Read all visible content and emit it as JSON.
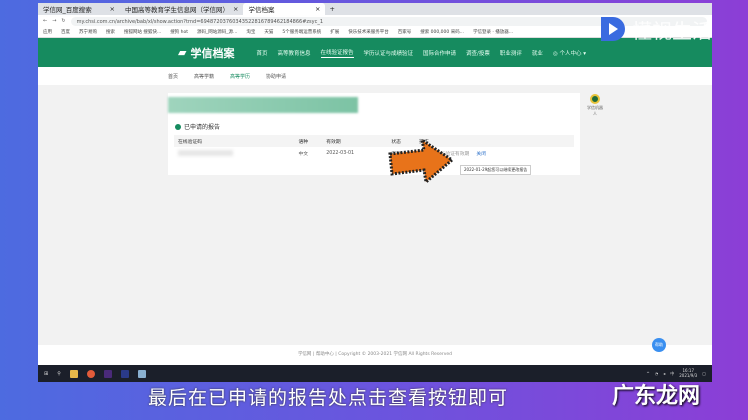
{
  "browser": {
    "tabs": [
      "学信网_百度搜索",
      "中国高等教育学生信息网（学信网）",
      "学信档案"
    ],
    "new_tab": "+",
    "url": "my.chsi.com.cn/archive/bab/xl/show.action?trnd=69487203760343522816789462184866#zsyc_1",
    "bookmarks": [
      "应用",
      "百度",
      "苏宁易购",
      "搜索",
      "搜狐网站 搜狐快...",
      "搜狗 hot",
      "源码_网站源码_源...",
      "淘宝",
      "天猫",
      "5个服务端运营系统",
      "扩展",
      "快乐技术采服务平台",
      "百家号",
      "搜索 000,000 采码...",
      "学信登录 · 播放器..."
    ]
  },
  "site": {
    "logo": "学信档案",
    "nav": [
      "首页",
      "高等教育信息",
      "在线验证报告",
      "学历认证与成绩验证",
      "国际合作申请",
      "调查/投票",
      "职业测评",
      "就业",
      "个人中心"
    ],
    "subnav": [
      "首页",
      "高等学籍",
      "高等学历",
      "协助申请"
    ]
  },
  "report": {
    "title": "已申请的报告",
    "columns": [
      "在线验证码",
      "语种",
      "有效期",
      "状态",
      "操作"
    ],
    "rows": [
      {
        "code": "",
        "lang": "中文",
        "expiry": "2022-03-01",
        "status": "有效",
        "actions": [
          "查看",
          "延长验证有效期",
          "关闭"
        ]
      }
    ],
    "tooltip": "2022-01-29起您可以继续更改报告"
  },
  "robot": {
    "label": "学信机器人"
  },
  "footer": {
    "links": [
      "学信网",
      "帮助中心"
    ],
    "copyright": "Copyright © 2003-2021 学信网 All Rights Reserved"
  },
  "help_button": "帮助",
  "taskbar": {
    "time": "16:17",
    "date": "2021/9/3",
    "ime": "中"
  },
  "subtitle": "最后在已申请的报告处点击查看按钮即可",
  "watermarks": {
    "top": "懂视生活",
    "bottom": "广东龙网"
  }
}
